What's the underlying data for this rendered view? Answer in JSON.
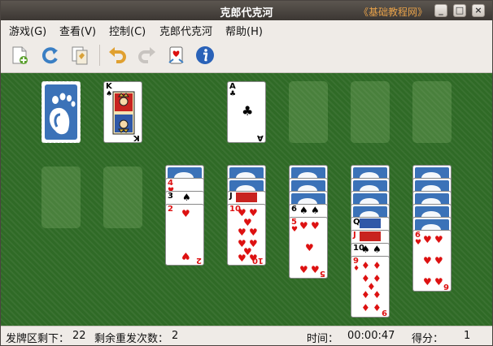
{
  "window": {
    "title": "克郎代克河",
    "watermark": "《基础教程网》",
    "controls": {
      "minimize": "_",
      "maximize": "□",
      "close": "×"
    }
  },
  "menu": [
    "游戏(G)",
    "查看(V)",
    "控制(C)",
    "克郎代克河",
    "帮助(H)"
  ],
  "toolbar": {
    "icons": [
      "new-game-icon",
      "restart-icon",
      "select-game-icon",
      "undo-icon",
      "redo-icon",
      "deal-icon",
      "info-icon"
    ]
  },
  "game": {
    "stock": {
      "back_logo": "gnome-foot-icon"
    },
    "waste": {
      "rank": "K",
      "suit": "♠"
    },
    "foundations": [
      {
        "rank": "A",
        "suit": "♣"
      },
      null,
      null,
      null
    ],
    "tableau": [
      {
        "face_down": 0,
        "face_up": []
      },
      {
        "face_down": 0,
        "face_up": []
      },
      {
        "face_down": 1,
        "face_up": [
          {
            "rank": "4",
            "suit": "♥"
          },
          {
            "rank": "3",
            "suit": "♠"
          },
          {
            "rank": "2",
            "suit": "♥"
          }
        ]
      },
      {
        "face_down": 2,
        "face_up": [
          {
            "rank": "J",
            "suit": "♠"
          },
          {
            "rank": "10",
            "suit": "♥"
          }
        ]
      },
      {
        "face_down": 3,
        "face_up": [
          {
            "rank": "6",
            "suit": "♠"
          },
          {
            "rank": "5",
            "suit": "♥"
          }
        ]
      },
      {
        "face_down": 4,
        "face_up": [
          {
            "rank": "Q",
            "suit": "♠"
          },
          {
            "rank": "J",
            "suit": "♥"
          },
          {
            "rank": "10",
            "suit": "♠"
          },
          {
            "rank": "9",
            "suit": "♦"
          }
        ]
      },
      {
        "face_down": 5,
        "face_up": [
          {
            "rank": "6",
            "suit": "♥"
          }
        ]
      }
    ],
    "bottom_ranks": {
      "col3": "2",
      "col4": "10",
      "col5": "5",
      "col6": "9",
      "col7": "6"
    }
  },
  "status": {
    "stock_label": "发牌区剩下：",
    "stock_count": "22",
    "redeals_label": "剩余重发次数：",
    "redeals_count": "2",
    "time_label": "时间：",
    "time_value": "00:00:47",
    "score_label": "得分：",
    "score_value": "1"
  },
  "colors": {
    "felt": "#2f6a26",
    "card_back": "#3b72b8",
    "red_suit": "#dd1111"
  }
}
